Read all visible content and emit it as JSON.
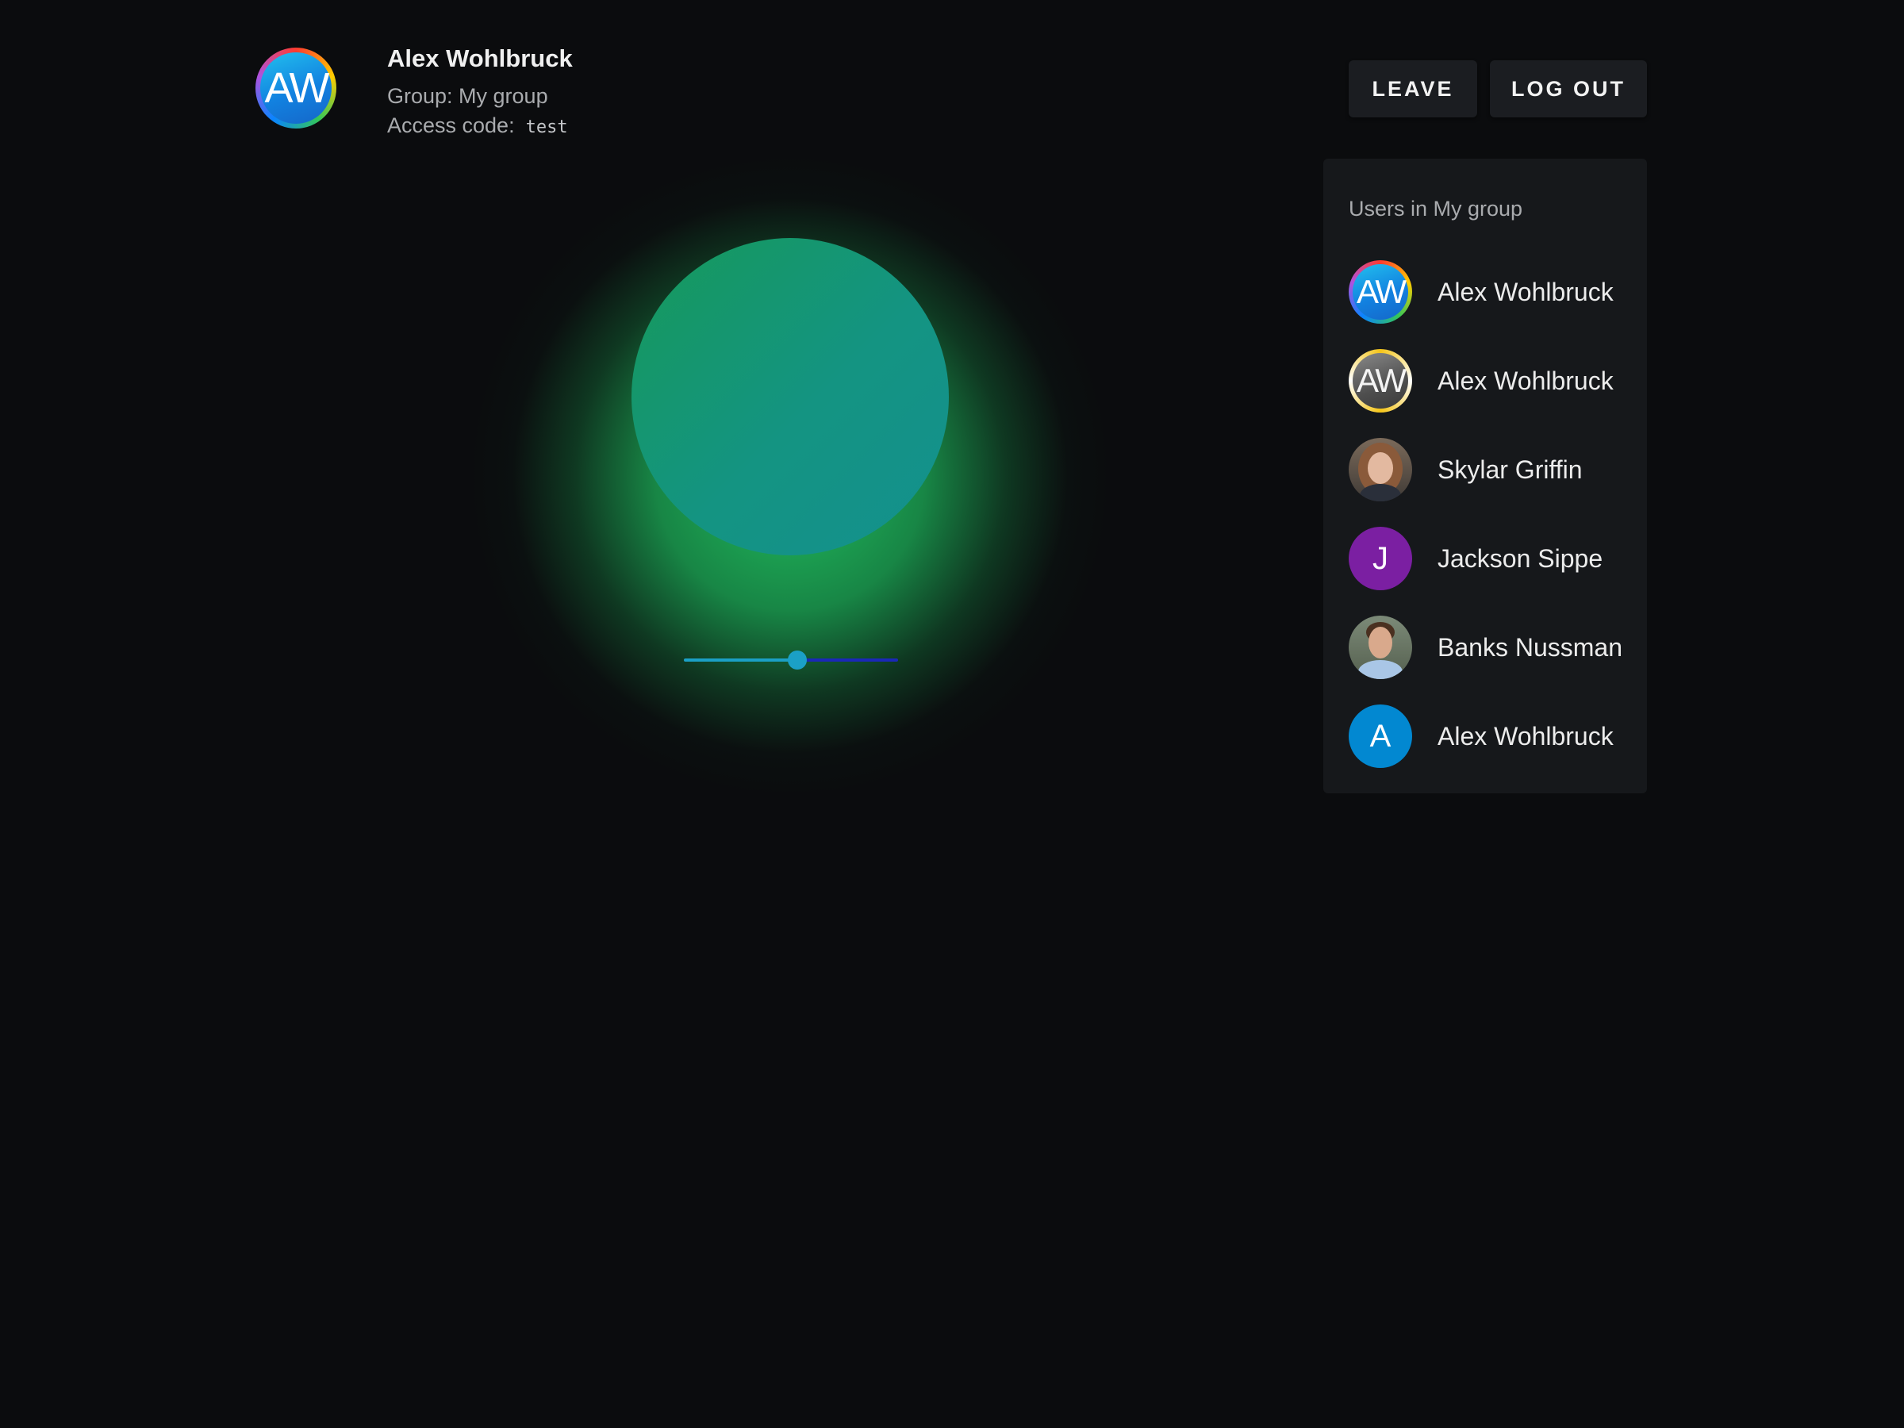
{
  "user": {
    "name": "Alex Wohlbruck",
    "initials": "AW",
    "group_line": "Group: My group",
    "access_label": "Access code:",
    "access_code": "test"
  },
  "actions": {
    "leave_label": "LEAVE",
    "logout_label": "LOG OUT"
  },
  "slider": {
    "value_fraction": 0.53,
    "left_color": "#1ba0c6",
    "right_color": "#1a28b8"
  },
  "panel": {
    "title": "Users in My group",
    "users": [
      {
        "name": "Alex Wohlbruck",
        "avatar_text": "AW",
        "avatar_style": "rainbow-ring"
      },
      {
        "name": "Alex Wohlbruck",
        "avatar_text": "AW",
        "avatar_style": "gold-ring"
      },
      {
        "name": "Skylar Griffin",
        "avatar_style": "photo"
      },
      {
        "name": "Jackson Sippe",
        "avatar_text": "J",
        "avatar_color": "#7b1fa2"
      },
      {
        "name": "Banks Nussman",
        "avatar_style": "photo"
      },
      {
        "name": "Alex Wohlbruck",
        "avatar_text": "A",
        "avatar_color": "#0288d1"
      }
    ]
  },
  "colors": {
    "background": "#0b0c0e",
    "orb_glow": "#22c864",
    "orb_fill": "#149482"
  }
}
